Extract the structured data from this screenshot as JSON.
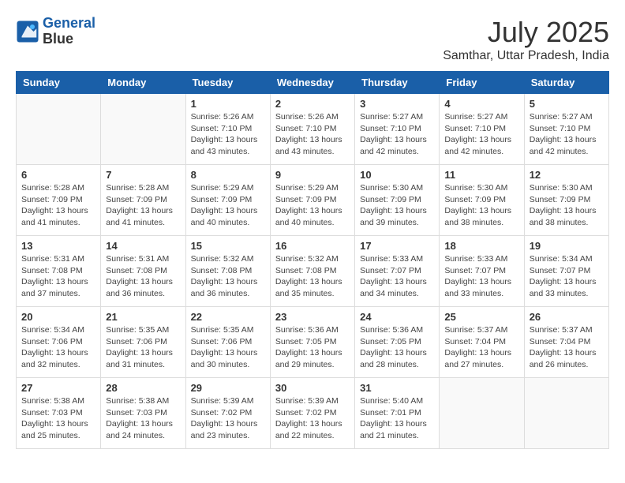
{
  "logo": {
    "line1": "General",
    "line2": "Blue"
  },
  "title": "July 2025",
  "subtitle": "Samthar, Uttar Pradesh, India",
  "weekdays": [
    "Sunday",
    "Monday",
    "Tuesday",
    "Wednesday",
    "Thursday",
    "Friday",
    "Saturday"
  ],
  "weeks": [
    [
      {
        "day": "",
        "info": ""
      },
      {
        "day": "",
        "info": ""
      },
      {
        "day": "1",
        "info": "Sunrise: 5:26 AM\nSunset: 7:10 PM\nDaylight: 13 hours and 43 minutes."
      },
      {
        "day": "2",
        "info": "Sunrise: 5:26 AM\nSunset: 7:10 PM\nDaylight: 13 hours and 43 minutes."
      },
      {
        "day": "3",
        "info": "Sunrise: 5:27 AM\nSunset: 7:10 PM\nDaylight: 13 hours and 42 minutes."
      },
      {
        "day": "4",
        "info": "Sunrise: 5:27 AM\nSunset: 7:10 PM\nDaylight: 13 hours and 42 minutes."
      },
      {
        "day": "5",
        "info": "Sunrise: 5:27 AM\nSunset: 7:10 PM\nDaylight: 13 hours and 42 minutes."
      }
    ],
    [
      {
        "day": "6",
        "info": "Sunrise: 5:28 AM\nSunset: 7:09 PM\nDaylight: 13 hours and 41 minutes."
      },
      {
        "day": "7",
        "info": "Sunrise: 5:28 AM\nSunset: 7:09 PM\nDaylight: 13 hours and 41 minutes."
      },
      {
        "day": "8",
        "info": "Sunrise: 5:29 AM\nSunset: 7:09 PM\nDaylight: 13 hours and 40 minutes."
      },
      {
        "day": "9",
        "info": "Sunrise: 5:29 AM\nSunset: 7:09 PM\nDaylight: 13 hours and 40 minutes."
      },
      {
        "day": "10",
        "info": "Sunrise: 5:30 AM\nSunset: 7:09 PM\nDaylight: 13 hours and 39 minutes."
      },
      {
        "day": "11",
        "info": "Sunrise: 5:30 AM\nSunset: 7:09 PM\nDaylight: 13 hours and 38 minutes."
      },
      {
        "day": "12",
        "info": "Sunrise: 5:30 AM\nSunset: 7:09 PM\nDaylight: 13 hours and 38 minutes."
      }
    ],
    [
      {
        "day": "13",
        "info": "Sunrise: 5:31 AM\nSunset: 7:08 PM\nDaylight: 13 hours and 37 minutes."
      },
      {
        "day": "14",
        "info": "Sunrise: 5:31 AM\nSunset: 7:08 PM\nDaylight: 13 hours and 36 minutes."
      },
      {
        "day": "15",
        "info": "Sunrise: 5:32 AM\nSunset: 7:08 PM\nDaylight: 13 hours and 36 minutes."
      },
      {
        "day": "16",
        "info": "Sunrise: 5:32 AM\nSunset: 7:08 PM\nDaylight: 13 hours and 35 minutes."
      },
      {
        "day": "17",
        "info": "Sunrise: 5:33 AM\nSunset: 7:07 PM\nDaylight: 13 hours and 34 minutes."
      },
      {
        "day": "18",
        "info": "Sunrise: 5:33 AM\nSunset: 7:07 PM\nDaylight: 13 hours and 33 minutes."
      },
      {
        "day": "19",
        "info": "Sunrise: 5:34 AM\nSunset: 7:07 PM\nDaylight: 13 hours and 33 minutes."
      }
    ],
    [
      {
        "day": "20",
        "info": "Sunrise: 5:34 AM\nSunset: 7:06 PM\nDaylight: 13 hours and 32 minutes."
      },
      {
        "day": "21",
        "info": "Sunrise: 5:35 AM\nSunset: 7:06 PM\nDaylight: 13 hours and 31 minutes."
      },
      {
        "day": "22",
        "info": "Sunrise: 5:35 AM\nSunset: 7:06 PM\nDaylight: 13 hours and 30 minutes."
      },
      {
        "day": "23",
        "info": "Sunrise: 5:36 AM\nSunset: 7:05 PM\nDaylight: 13 hours and 29 minutes."
      },
      {
        "day": "24",
        "info": "Sunrise: 5:36 AM\nSunset: 7:05 PM\nDaylight: 13 hours and 28 minutes."
      },
      {
        "day": "25",
        "info": "Sunrise: 5:37 AM\nSunset: 7:04 PM\nDaylight: 13 hours and 27 minutes."
      },
      {
        "day": "26",
        "info": "Sunrise: 5:37 AM\nSunset: 7:04 PM\nDaylight: 13 hours and 26 minutes."
      }
    ],
    [
      {
        "day": "27",
        "info": "Sunrise: 5:38 AM\nSunset: 7:03 PM\nDaylight: 13 hours and 25 minutes."
      },
      {
        "day": "28",
        "info": "Sunrise: 5:38 AM\nSunset: 7:03 PM\nDaylight: 13 hours and 24 minutes."
      },
      {
        "day": "29",
        "info": "Sunrise: 5:39 AM\nSunset: 7:02 PM\nDaylight: 13 hours and 23 minutes."
      },
      {
        "day": "30",
        "info": "Sunrise: 5:39 AM\nSunset: 7:02 PM\nDaylight: 13 hours and 22 minutes."
      },
      {
        "day": "31",
        "info": "Sunrise: 5:40 AM\nSunset: 7:01 PM\nDaylight: 13 hours and 21 minutes."
      },
      {
        "day": "",
        "info": ""
      },
      {
        "day": "",
        "info": ""
      }
    ]
  ]
}
